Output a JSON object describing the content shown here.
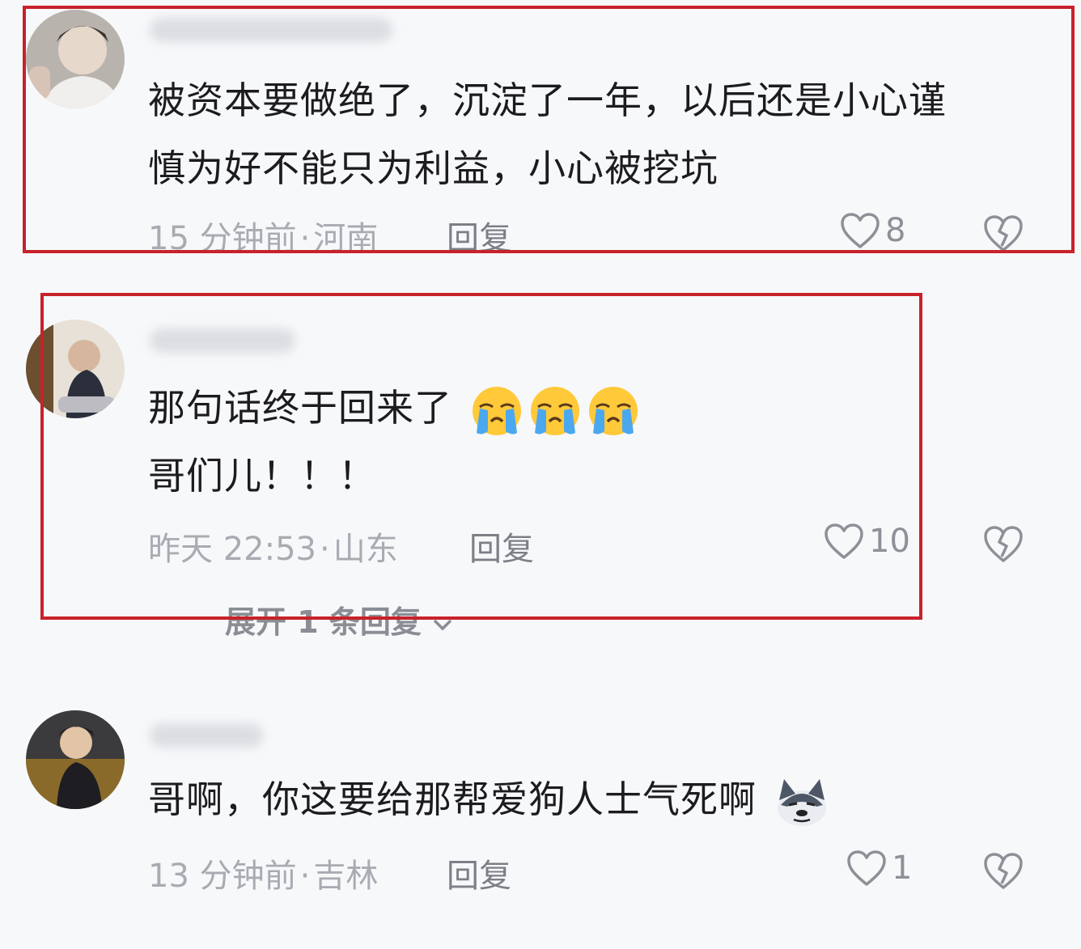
{
  "comments": [
    {
      "text_lines": [
        "被资本要做绝了，沉淀了一年，以后还是小心谨",
        "慎为好不能只为利益，小心被挖坑"
      ],
      "time": "15 分钟前",
      "location": "河南",
      "reply_label": "回复",
      "likes": "8"
    },
    {
      "text_lines": [
        "那句话终于回来了",
        "哥们儿！！！"
      ],
      "time": "昨天 22:53",
      "location": "山东",
      "reply_label": "回复",
      "likes": "10",
      "expand_label": "展开 1 条回复"
    },
    {
      "text_lines": [
        "哥啊，你这要给那帮爱狗人士气死啊"
      ],
      "time": "13 分钟前",
      "location": "吉林",
      "reply_label": "回复",
      "likes": "1"
    }
  ],
  "meta_separator": "·",
  "icons": [
    "heart-icon",
    "heart-broken-icon",
    "crying-face-emoji",
    "dog-face-emoji",
    "chevron-down-icon"
  ],
  "colors": {
    "highlight_box": "#c8222a",
    "meta_text": "#a9abb2"
  }
}
